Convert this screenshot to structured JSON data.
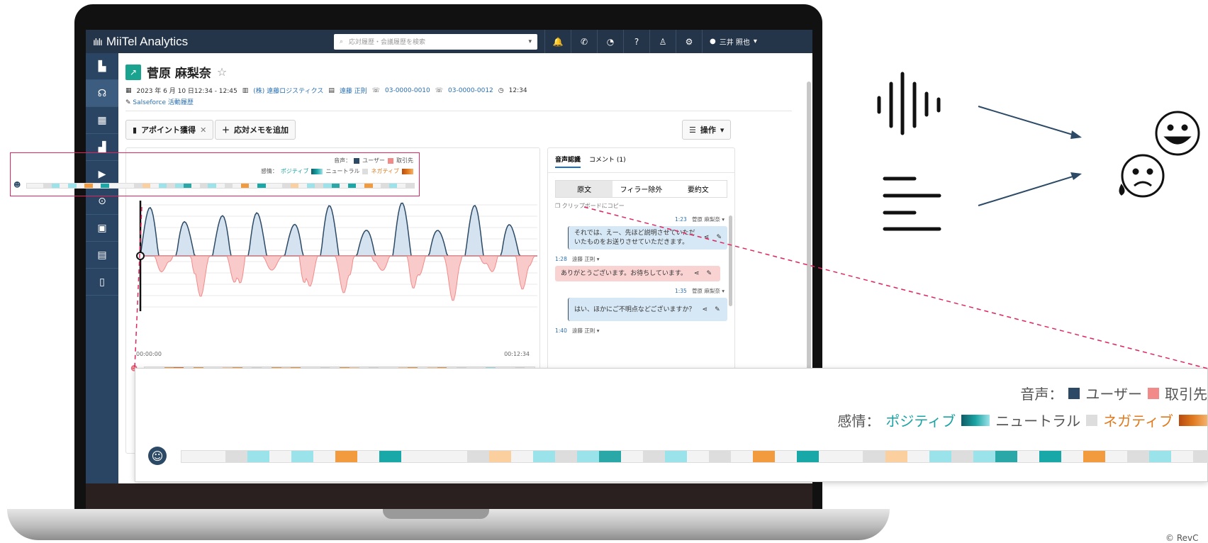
{
  "app": {
    "name": "MiiTel Analytics",
    "logo": "ılılı"
  },
  "search": {
    "placeholder": "応対履歴・会議履歴を検索"
  },
  "user": {
    "name": "三井 照也"
  },
  "topbar_icons": [
    "bell-icon",
    "phone-icon",
    "dashboard-icon",
    "help-icon",
    "agent-icon",
    "gear-icon"
  ],
  "sidebar_icons": [
    "analytics-icon",
    "headset-icon",
    "table-icon",
    "chart-icon",
    "video-icon",
    "robot-icon",
    "contact-icon",
    "clipboard-icon",
    "document-icon"
  ],
  "record": {
    "name": "菅原 麻梨奈",
    "datetime": "2023 年 6 月 10 日12:34 - 12:45",
    "company": "(株) 遠藤ロジスティクス",
    "contact": "遠藤 正則",
    "phone_from": "03-0000-0010",
    "phone_to": "03-0000-0012",
    "duration": "12:34",
    "salesforce": "Salseforce 活動履歴"
  },
  "buttons": {
    "appointment": "アポイント獲得",
    "add_memo": "応対メモを追加",
    "operations": "操作"
  },
  "legend": {
    "voice_label": "音声：",
    "user": "ユーザー",
    "customer": "取引先",
    "emotion_label": "感情：",
    "positive": "ポジティブ",
    "neutral": "ニュートラル",
    "negative": "ネガティブ"
  },
  "colors": {
    "user": "#2c4a66",
    "customer": "#f28a8a",
    "positive": "#1aa3a3",
    "negative": "#e07a1f",
    "neutral": "#dddddd",
    "accent": "#e0245e"
  },
  "waveform": {
    "start": "00:00:00",
    "end": "00:12:34"
  },
  "emotion_strip_top": [
    "#f3f3f3",
    "#f3f3f3",
    "#ddd",
    "#9be3ea",
    "#f3f3f3",
    "#9be3ea",
    "#f3f3f3",
    "#f19a3e",
    "#f3f3f3",
    "#18a8a8",
    "#f3f3f3",
    "#f3f3f3",
    "#f3f3f3",
    "#ddd",
    "#fbcf9e",
    "#f3f3f3",
    "#9be3ea",
    "#ddd",
    "#9be3ea",
    "#2aa8a8",
    "#f3f3f3",
    "#ddd",
    "#9be3ea",
    "#f3f3f3",
    "#ddd",
    "#f3f3f3",
    "#f19a3e",
    "#f3f3f3",
    "#18a8a8",
    "#f3f3f3",
    "#f3f3f3",
    "#ddd",
    "#fbcf9e",
    "#f3f3f3",
    "#9be3ea",
    "#ddd",
    "#9be3ea",
    "#2aa8a8",
    "#f3f3f3",
    "#18a8a8",
    "#f3f3f3",
    "#f19a3e",
    "#f3f3f3",
    "#ddd",
    "#9be3ea",
    "#f3f3f3",
    "#ddd"
  ],
  "emotion_strip_bottom": [
    "#f3f3f3",
    "#f3f3f3",
    "#f19a3e",
    "#e86a1a",
    "#f3f3f3",
    "#f19a3e",
    "#f3f3f3",
    "#f3f3f3",
    "#fbcf9e",
    "#f19a3e",
    "#f3f3f3",
    "#ddd",
    "#f3f3f3",
    "#f19a3e",
    "#fbcf9e",
    "#f19a3e",
    "#f3f3f3",
    "#f3f3f3",
    "#ddd",
    "#f3f3f3",
    "#f19a3e",
    "#fbcf9e",
    "#f3f3f3",
    "#ddd",
    "#f3f3f3",
    "#f3f3f3",
    "#fbcf9e",
    "#f19a3e",
    "#f3f3f3",
    "#fbcf9e",
    "#f19a3e",
    "#f3f3f3",
    "#ddd",
    "#f3f3f3",
    "#f3f3f3",
    "#9be3ea",
    "#f3f3f3",
    "#f3f3f3",
    "#ddd",
    "#f3f3f3"
  ],
  "transcript": {
    "tabs": [
      "音声認識",
      "コメント (1)"
    ],
    "modes": [
      "原文",
      "フィラー除外",
      "要約文"
    ],
    "copy": "クリップボードにコピー",
    "messages": [
      {
        "time": "1:23",
        "speaker": "菅原 麻梨奈",
        "text": "それでは、えー、先ほど説明させていただいたものをお送りさせていただきます。",
        "side": "user"
      },
      {
        "time": "1:28",
        "speaker": "遠藤 正則",
        "text": "ありがとうございます。お待ちしています。",
        "side": "cust"
      },
      {
        "time": "1:35",
        "speaker": "菅原 麻梨奈",
        "text": "はい、ほかにご不明点などございますか？",
        "side": "user"
      },
      {
        "time": "1:40",
        "speaker": "遠藤 正則",
        "text": "",
        "side": "cust"
      }
    ]
  },
  "copyright": "© RevC"
}
